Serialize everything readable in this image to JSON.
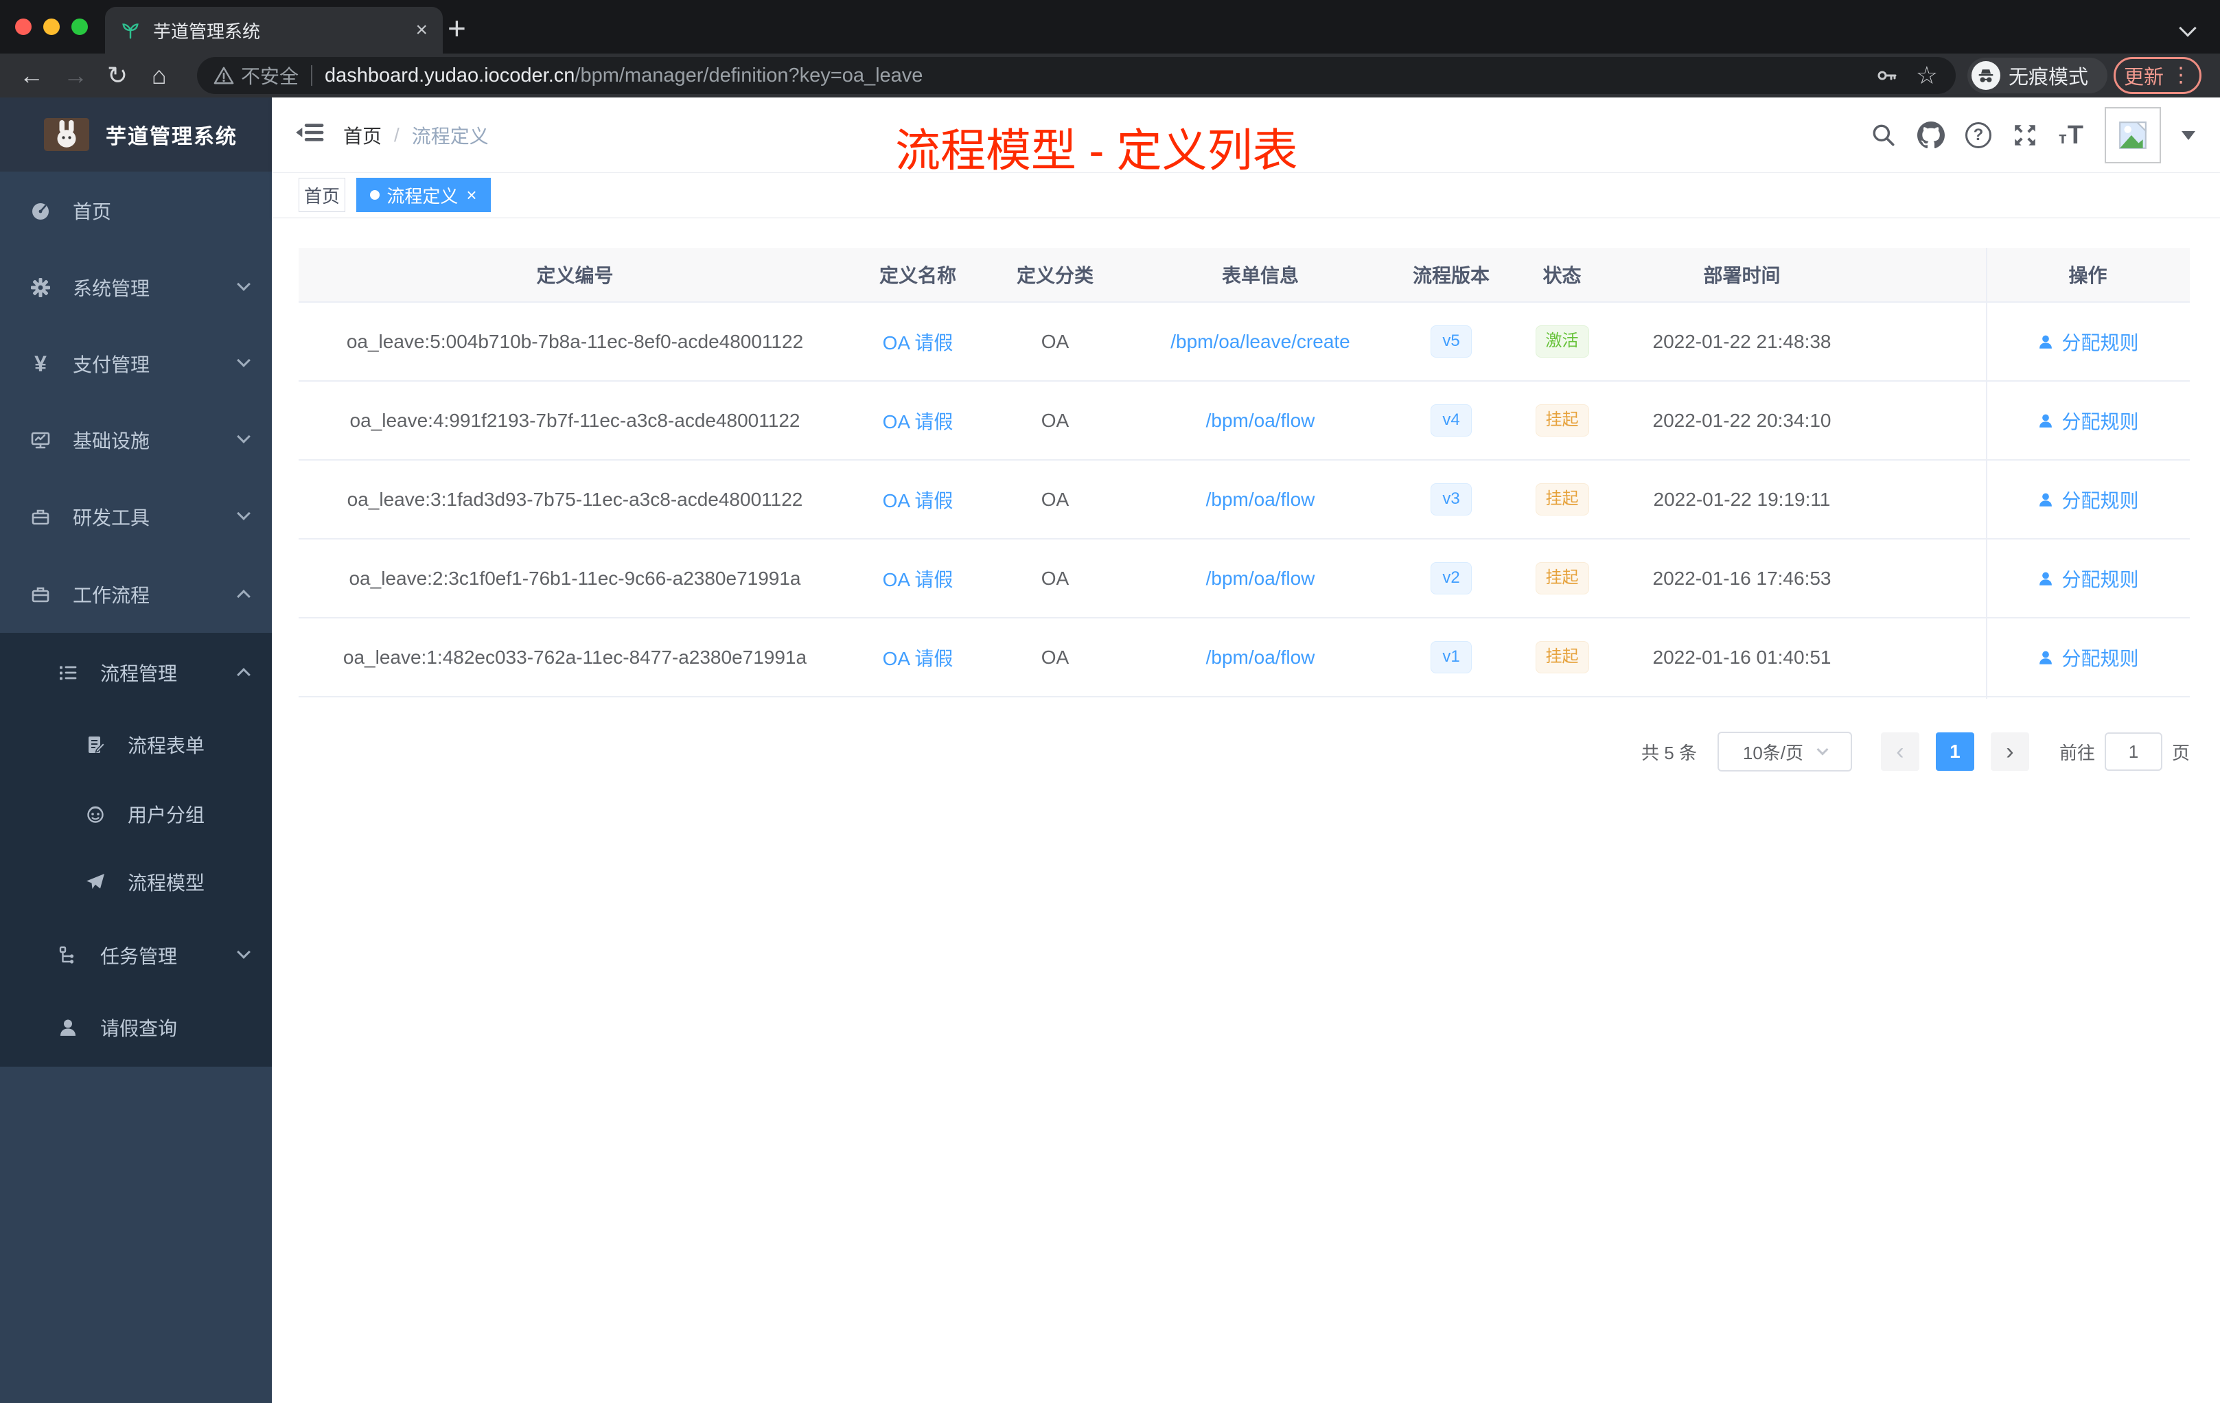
{
  "browser": {
    "tab_title": "芋道管理系统",
    "not_secure": "不安全",
    "url_host": "dashboard.yudao.iocoder.cn",
    "url_path": "/bpm/manager/definition?key=oa_leave",
    "incognito": "无痕模式",
    "update": "更新"
  },
  "glyphs": {
    "back": "←",
    "forward": "→",
    "reload": "↻",
    "home": "⌂",
    "star": "☆",
    "kebab": "⋮",
    "close": "×",
    "plus": "+",
    "prev": "‹",
    "next": "›",
    "yen": "¥",
    "question": "?",
    "tt_small": "т",
    "tt_large": "T"
  },
  "sidebar": {
    "brand": "芋道管理系统",
    "items": [
      {
        "label": "首页"
      },
      {
        "label": "系统管理"
      },
      {
        "label": "支付管理"
      },
      {
        "label": "基础设施"
      },
      {
        "label": "研发工具"
      },
      {
        "label": "工作流程"
      },
      {
        "label": "流程管理"
      },
      {
        "label": "流程表单"
      },
      {
        "label": "用户分组"
      },
      {
        "label": "流程模型"
      },
      {
        "label": "任务管理"
      },
      {
        "label": "请假查询"
      }
    ]
  },
  "navbar": {
    "breadcrumb_home": "首页",
    "breadcrumb_sep": "/",
    "breadcrumb_current": "流程定义",
    "annotation": "流程模型 - 定义列表"
  },
  "tags": [
    {
      "label": "首页"
    },
    {
      "label": "流程定义"
    }
  ],
  "table": {
    "columns": [
      "定义编号",
      "定义名称",
      "定义分类",
      "表单信息",
      "流程版本",
      "状态",
      "部署时间",
      "操作"
    ],
    "rows": [
      {
        "id": "oa_leave:5:004b710b-7b8a-11ec-8ef0-acde48001122",
        "name": "OA 请假",
        "category": "OA",
        "form": "/bpm/oa/leave/create",
        "version": "v5",
        "status": "激活",
        "time": "2022-01-22 21:48:38",
        "action": "分配规则"
      },
      {
        "id": "oa_leave:4:991f2193-7b7f-11ec-a3c8-acde48001122",
        "name": "OA 请假",
        "category": "OA",
        "form": "/bpm/oa/flow",
        "version": "v4",
        "status": "挂起",
        "time": "2022-01-22 20:34:10",
        "action": "分配规则"
      },
      {
        "id": "oa_leave:3:1fad3d93-7b75-11ec-a3c8-acde48001122",
        "name": "OA 请假",
        "category": "OA",
        "form": "/bpm/oa/flow",
        "version": "v3",
        "status": "挂起",
        "time": "2022-01-22 19:19:11",
        "action": "分配规则"
      },
      {
        "id": "oa_leave:2:3c1f0ef1-76b1-11ec-9c66-a2380e71991a",
        "name": "OA 请假",
        "category": "OA",
        "form": "/bpm/oa/flow",
        "version": "v2",
        "status": "挂起",
        "time": "2022-01-16 17:46:53",
        "action": "分配规则"
      },
      {
        "id": "oa_leave:1:482ec033-762a-11ec-8477-a2380e71991a",
        "name": "OA 请假",
        "category": "OA",
        "form": "/bpm/oa/flow",
        "version": "v1",
        "status": "挂起",
        "time": "2022-01-16 01:40:51",
        "action": "分配规则"
      }
    ]
  },
  "pagination": {
    "total": "共 5 条",
    "page_size": "10条/页",
    "page": "1",
    "goto": "前往",
    "goto_value": "1",
    "unit": "页"
  },
  "colors": {
    "accent": "#409eff",
    "annotation_red": "#fe2b00",
    "success": "#67c23a",
    "warning": "#e6a23c",
    "sidebar_bg": "#304156",
    "sidebar_sub_bg": "#1f2d3d"
  }
}
